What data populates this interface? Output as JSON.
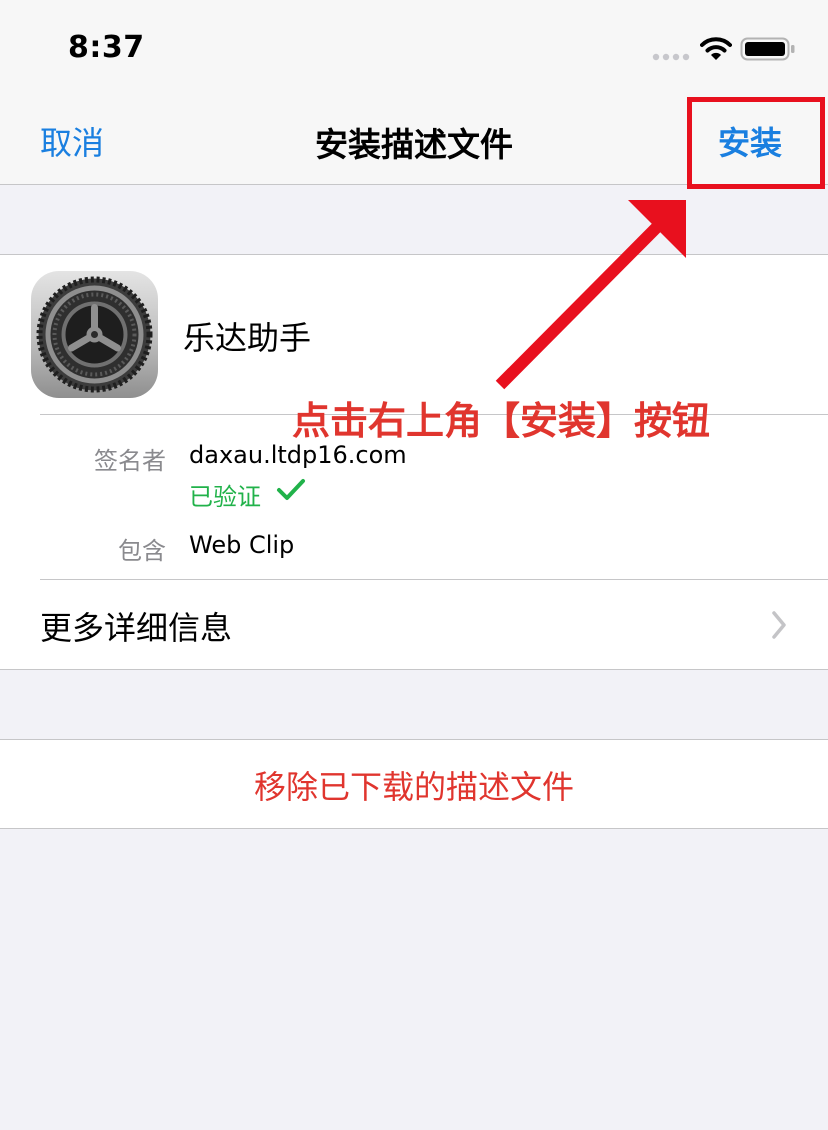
{
  "status_bar": {
    "time": "8:37"
  },
  "nav": {
    "cancel_label": "取消",
    "title": "安装描述文件",
    "install_label": "安装"
  },
  "profile": {
    "name": "乐达助手",
    "icon": "settings-gear-icon",
    "signer_label": "签名者",
    "signer_value": "daxau.ltdp16.com",
    "verified_label": "已验证",
    "contains_label": "包含",
    "contains_value": "Web Clip",
    "more_details_label": "更多详细信息"
  },
  "remove_label": "移除已下载的描述文件",
  "annotation": {
    "text": "点击右上角【安装】按钮"
  },
  "colors": {
    "ios_blue": "#1a7fe0",
    "destructive_red": "#e0352e",
    "verified_green": "#21b24a",
    "annotation_red": "#e8101e",
    "grouped_background": "#f2f2f7"
  }
}
